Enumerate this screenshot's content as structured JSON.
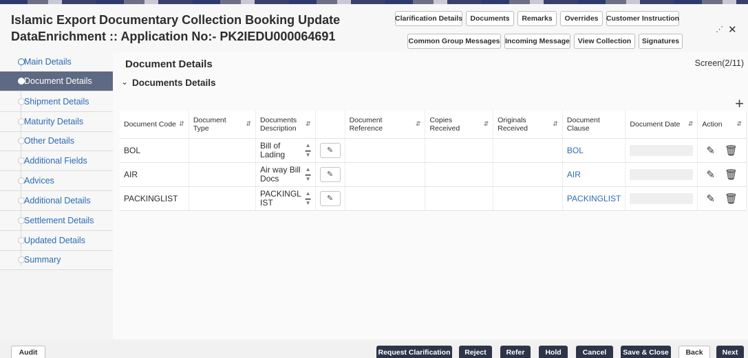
{
  "header": {
    "title_line1": "Islamic Export Documentary Collection Booking Update",
    "title_line2": "DataEnrichment :: Application No:- PK2IEDU000064691",
    "buttons_row1": [
      "Clarification Details",
      "Documents",
      "Remarks",
      "Overrides",
      "Customer Instruction"
    ],
    "buttons_row2": [
      "Common Group Messages",
      "Incoming Message",
      "View Collection",
      "Signatures"
    ],
    "icons": [
      "collapse-icon",
      "close-icon"
    ]
  },
  "sidebar": {
    "items": [
      {
        "label": "Main Details"
      },
      {
        "label": "Document Details",
        "active": true
      },
      {
        "label": "Shipment Details"
      },
      {
        "label": "Maturity Details"
      },
      {
        "label": "Other Details"
      },
      {
        "label": "Additional Fields"
      },
      {
        "label": "Advices"
      },
      {
        "label": "Additional Details"
      },
      {
        "label": "Settlement Details"
      },
      {
        "label": "Updated Details"
      },
      {
        "label": "Summary"
      }
    ]
  },
  "main": {
    "section_title": "Document Details",
    "screen_indicator": "Screen(2/11)",
    "subsection_title": "Documents Details"
  },
  "table": {
    "columns": [
      "Document Code",
      "Document Type",
      "Documents Description",
      "",
      "Document Reference",
      "Copies Received",
      "Originals Received",
      "Document Clause",
      "Document Date",
      "Action"
    ],
    "rows": [
      {
        "code": "BOL",
        "type": "",
        "description": "Bill of Lading",
        "reference": "",
        "copies": "",
        "originals": "",
        "clause": "BOL",
        "date": ""
      },
      {
        "code": "AIR",
        "type": "",
        "description": "Air way Bill Docs",
        "reference": "",
        "copies": "",
        "originals": "",
        "clause": "AIR",
        "date": ""
      },
      {
        "code": "PACKINGLIST",
        "type": "",
        "description": "PACKINGL IST",
        "reference": "",
        "copies": "",
        "originals": "",
        "clause": "PACKINGLIST",
        "date": ""
      }
    ]
  },
  "footer": {
    "audit": "Audit",
    "buttons": [
      "Request Clarification",
      "Reject",
      "Refer",
      "Hold",
      "Cancel",
      "Save & Close",
      "Back",
      "Next"
    ]
  },
  "colors": {
    "accent": "#5e6a84",
    "link": "#2a6bb3",
    "footer_button": "#2f3548"
  }
}
